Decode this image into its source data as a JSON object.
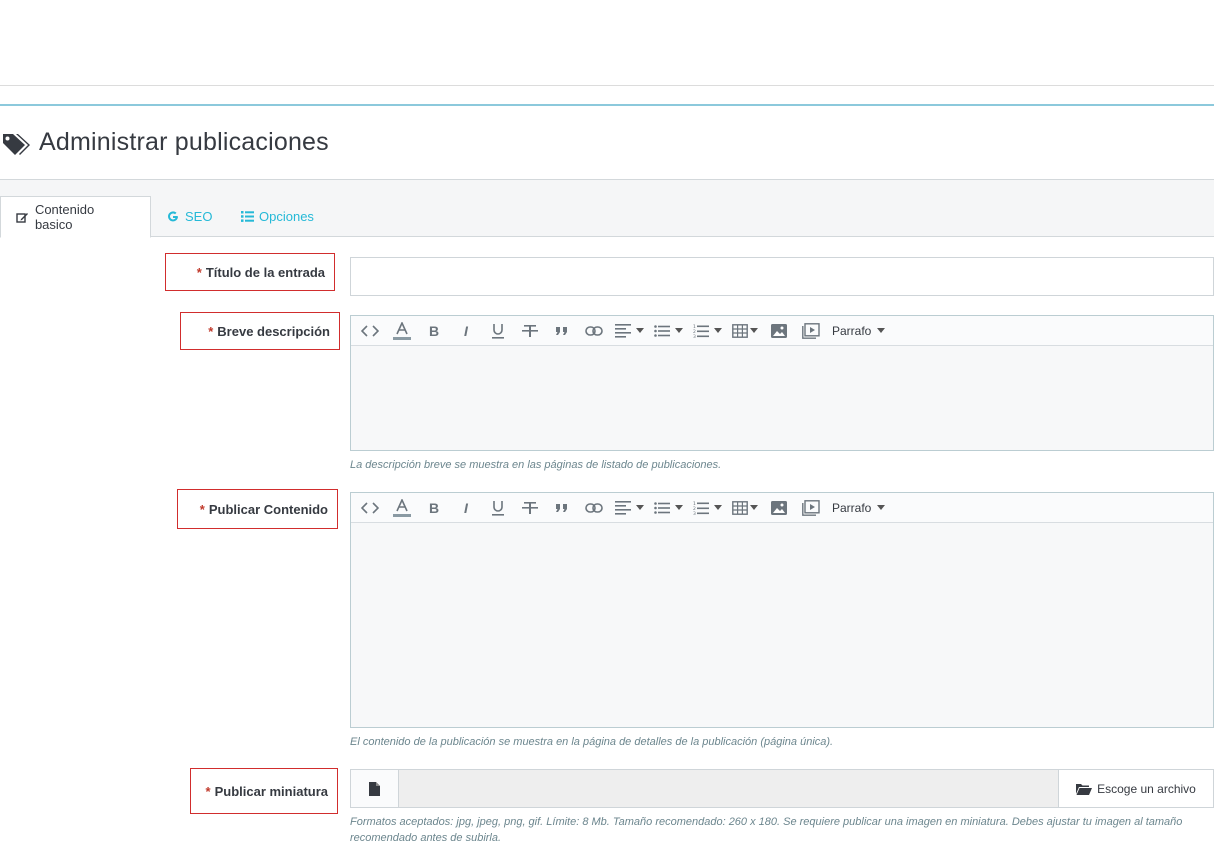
{
  "header": {
    "title": "Administrar publicaciones",
    "title_icon": "tags-icon"
  },
  "tabs": [
    {
      "label": "Contenido basico",
      "icon": "edit-icon",
      "active": true
    },
    {
      "label": "SEO",
      "icon": "google-icon",
      "active": false
    },
    {
      "label": "Opciones",
      "icon": "list-icon",
      "active": false
    }
  ],
  "form": {
    "required_mark": "*",
    "title_field": {
      "label": "Título de la entrada",
      "value": ""
    },
    "short_description": {
      "label": "Breve descripción",
      "help": "La descripción breve se muestra en las páginas de listado de publicaciones."
    },
    "content": {
      "label": "Publicar Contenido",
      "help": "El contenido de la publicación se muestra en la página de detalles de la publicación (página única)."
    },
    "thumbnail": {
      "label": "Publicar miniatura",
      "button_label": "Escoge un archivo",
      "help": "Formatos aceptados: jpg, jpeg, png, gif. Límite: 8 Mb. Tamaño recomendado: 260 x 180. Se requiere publicar una imagen en miniatura. Debes ajustar tu imagen al tamaño recomendado antes de subirla."
    }
  },
  "editor_toolbar": {
    "paragraph_label": "Parrafo"
  },
  "colors": {
    "accent": "#25b9d7",
    "required": "#c0392b",
    "highlight_border": "#d12d2d"
  }
}
